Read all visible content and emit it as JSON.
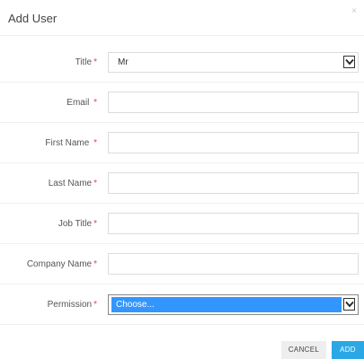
{
  "modal": {
    "title": "Add User",
    "close_glyph": "×"
  },
  "form": {
    "required_marker": "*",
    "title_label": "Title",
    "title_value": "Mr",
    "email_label": "Email",
    "email_value": "",
    "first_name_label": "First Name",
    "first_name_value": "",
    "last_name_label": "Last Name",
    "last_name_value": "",
    "job_title_label": "Job Title",
    "job_title_value": "",
    "company_name_label": "Company Name",
    "company_name_value": "",
    "permission_label": "Permission",
    "permission_value": "Choose..."
  },
  "footer": {
    "cancel_label": "CANCEL",
    "add_label": "ADD"
  },
  "colors": {
    "required": "#e0464b",
    "add_button": "#2aa8e6",
    "selected_option": "#3396ff"
  },
  "icons": {
    "close": "close-icon",
    "dropdown": "chevron-down-icon"
  }
}
